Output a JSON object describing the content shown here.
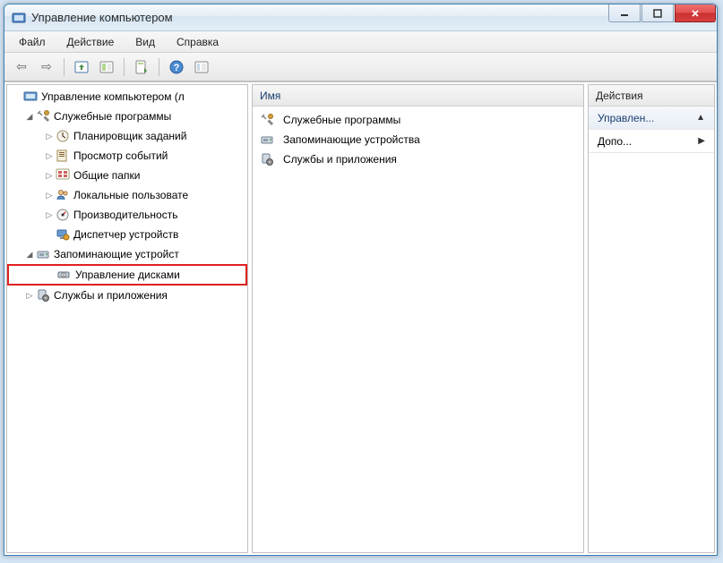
{
  "window": {
    "title": "Управление компьютером"
  },
  "menu": {
    "file": "Файл",
    "action": "Действие",
    "view": "Вид",
    "help": "Справка"
  },
  "tree": {
    "root": "Управление компьютером (л",
    "system_tools": "Служебные программы",
    "task_scheduler": "Планировщик заданий",
    "event_viewer": "Просмотр событий",
    "shared_folders": "Общие папки",
    "local_users": "Локальные пользовате",
    "performance": "Производительность",
    "device_manager": "Диспетчер устройств",
    "storage": "Запоминающие устройст",
    "disk_management": "Управление дисками",
    "services_apps": "Службы и приложения"
  },
  "list": {
    "header": "Имя",
    "items": {
      "system_tools": "Служебные программы",
      "storage": "Запоминающие устройства",
      "services_apps": "Службы и приложения"
    }
  },
  "actions": {
    "header": "Действия",
    "group": "Управлен...",
    "more": "Допо..."
  }
}
